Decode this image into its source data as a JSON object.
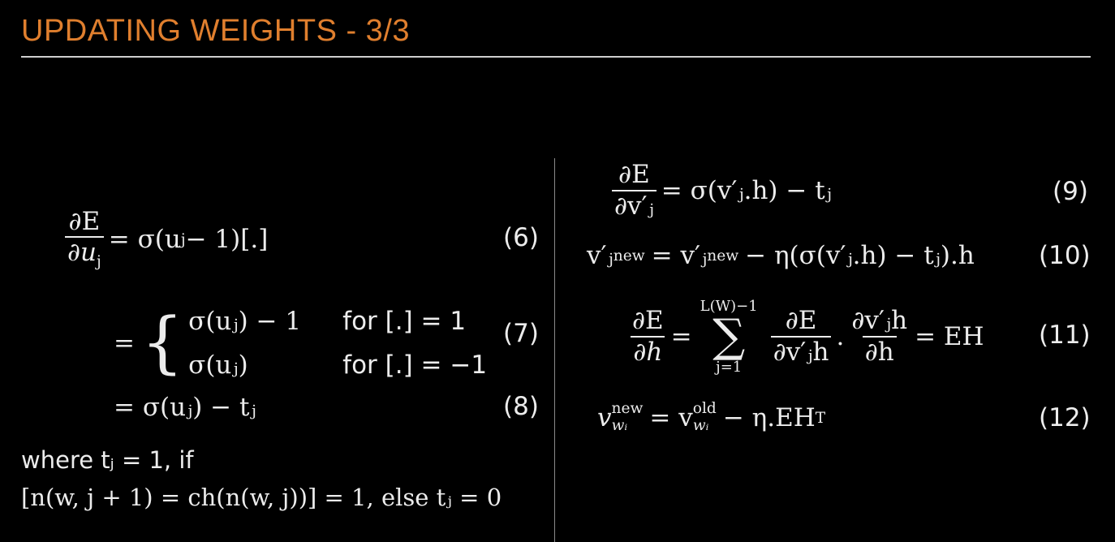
{
  "title": "UPDATING WEIGHTS - 3/3",
  "left": {
    "eq6": {
      "num": "∂E",
      "den": "∂u",
      "den_sub": "j",
      "rhs": "= σ(u",
      "rhs_sub": "j",
      "rhs_tail": " − 1)[.]",
      "number": "(6)"
    },
    "eq7": {
      "lead": "=",
      "case1_expr": "σ(uⱼ) − 1",
      "case1_cond": "for [.] = 1",
      "case2_expr": "σ(uⱼ)",
      "case2_cond": "for [.] = −1",
      "number": "(7)"
    },
    "eq8": {
      "text": "= σ(uⱼ) − tⱼ",
      "number": "(8)"
    },
    "where1": "where tⱼ = 1, if",
    "where2": "[n(w, j + 1) = ch(n(w, j))] = 1, else tⱼ = 0"
  },
  "right": {
    "eq9": {
      "num": "∂E",
      "den": "∂v′ⱼ",
      "rhs": "= σ(v′ⱼ.h) − tⱼ",
      "number": "(9)"
    },
    "eq10": {
      "lhs": "v′ⱼ",
      "lhs_sup": "new",
      "mid": "= v′ⱼ",
      "mid_sup": "new",
      "rhs": "− η(σ(v′ⱼ.h) − tⱼ).h",
      "number": "(10)"
    },
    "eq11": {
      "num": "∂E",
      "den": "∂h",
      "eq": "=",
      "sum_upper": "L(W)−1",
      "sum_sym": "∑",
      "sum_lower": "j=1",
      "f1_num": "∂E",
      "f1_den": "∂v′ⱼh",
      "dot": ".",
      "f2_num": "∂v′ⱼh",
      "f2_den": "∂h",
      "rhs": "= EH",
      "number": "(11)"
    },
    "eq12": {
      "lhs": "v",
      "lhs_sup": "new",
      "lhs_sub": "wᵢ",
      "mid": "= v",
      "mid_sup": "old",
      "mid_sub": "wᵢ",
      "rhs": "− η.EH",
      "rhs_sup": "T",
      "number": "(12)"
    }
  }
}
